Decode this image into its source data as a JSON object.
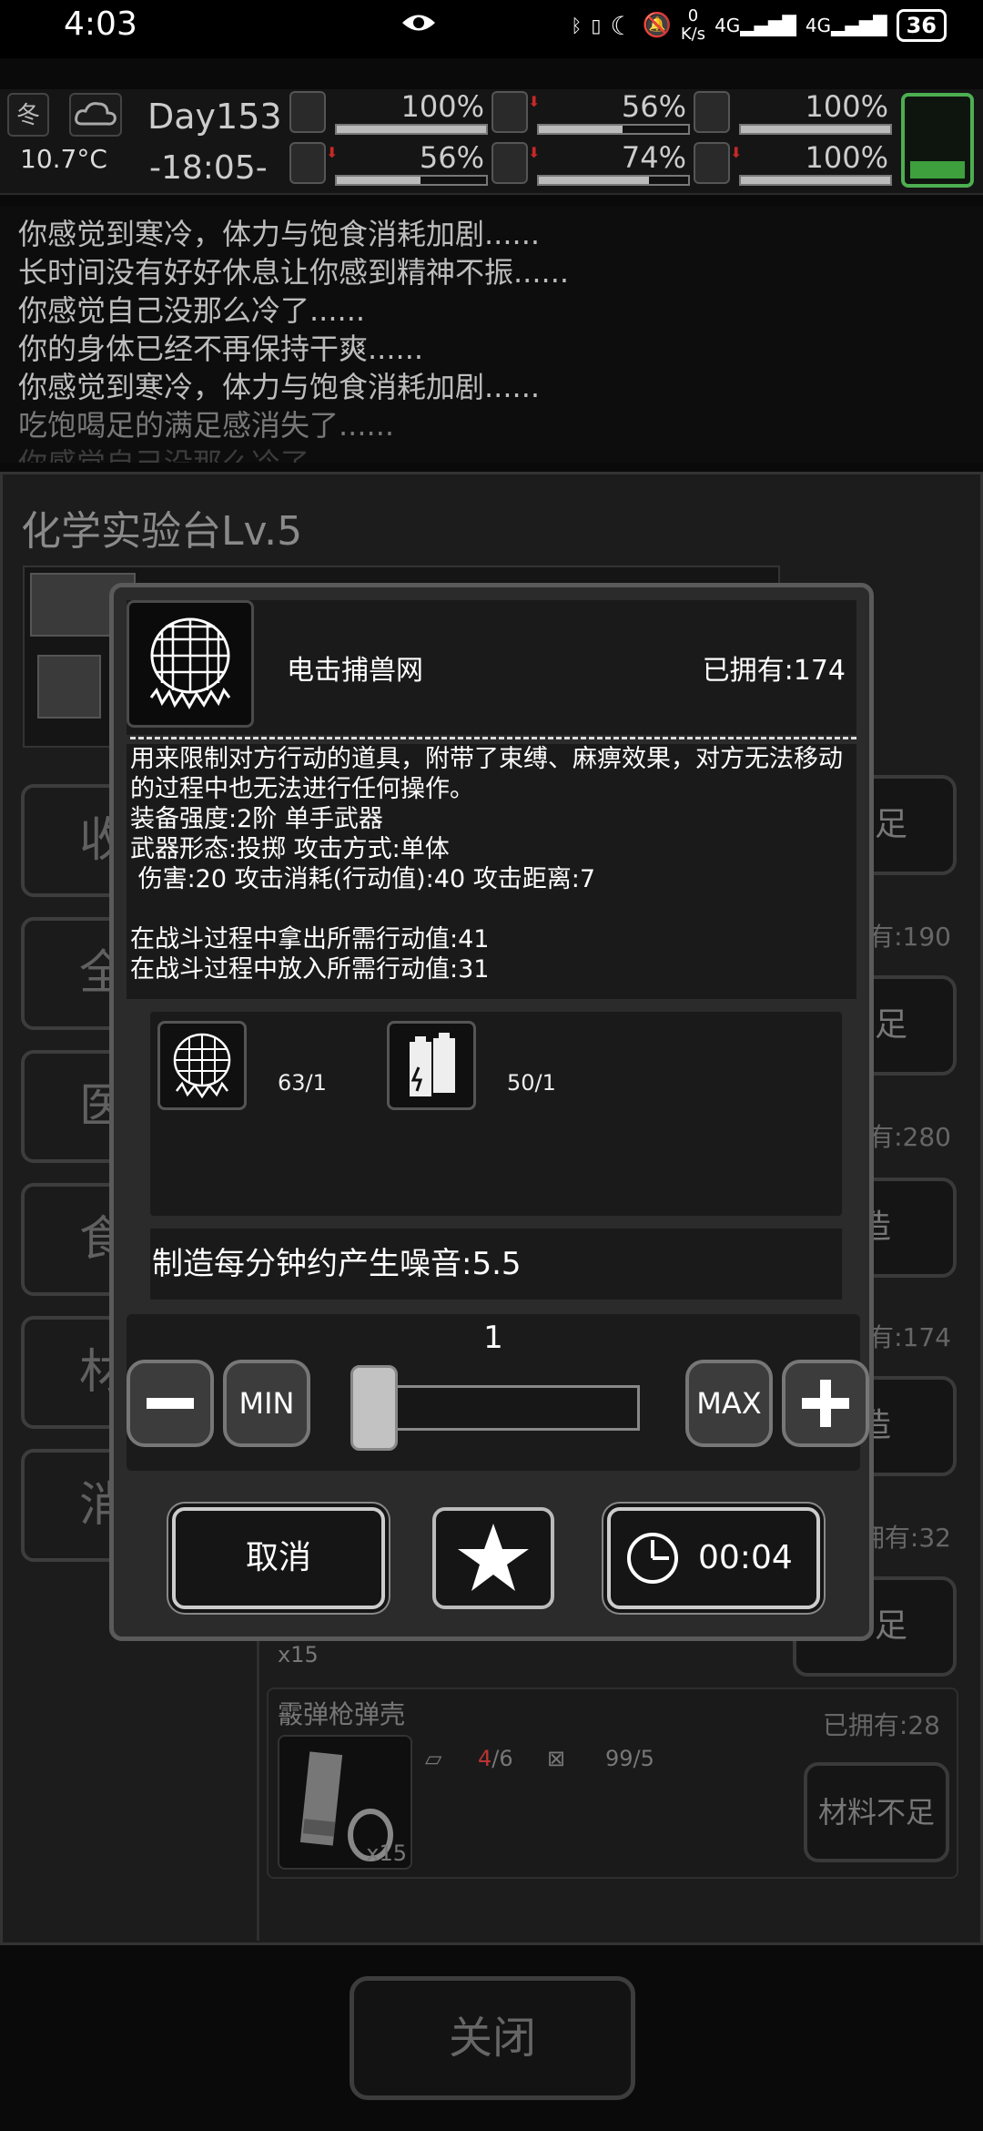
{
  "status_bar": {
    "time": "4:03",
    "net_speed_value": "0",
    "net_speed_unit": "K/s",
    "signal_1": "4G",
    "signal_2": "4G",
    "battery": "36"
  },
  "hud": {
    "season": "冬",
    "temperature": "10.7°C",
    "day": "Day153",
    "clock": "-18:05-",
    "stats": [
      {
        "icon": "medkit-icon",
        "value": "100%",
        "level": 1.0,
        "down": false
      },
      {
        "icon": "stomach-icon",
        "value": "56%",
        "level": 0.56,
        "down": true
      },
      {
        "icon": "mood-icon",
        "value": "100%",
        "level": 1.0,
        "down": false
      },
      {
        "icon": "boot-icon",
        "value": "56%",
        "level": 0.56,
        "down": true
      },
      {
        "icon": "water-drop-icon",
        "value": "74%",
        "level": 0.74,
        "down": true
      },
      {
        "icon": "heart-icon",
        "value": "100%",
        "level": 1.0,
        "down": true
      }
    ],
    "stamina_level": 0.2
  },
  "log": [
    "你感觉到寒冷，体力与饱食消耗加剧......",
    "长时间没有好好休息让你感到精神不振......",
    "你感觉自己没那么冷了......",
    "你的身体已经不再保持干爽......",
    "你感觉到寒冷，体力与饱食消耗加剧......",
    "吃饱喝足的满足感消失了......",
    "你感觉自己没那么冷了......"
  ],
  "background": {
    "title": "化学实验台Lv.5",
    "categories": [
      "收",
      "全",
      "医",
      "食",
      "材",
      "消"
    ],
    "owned_labels": [
      "有:190",
      "有:280",
      "有:174",
      "拥有:32"
    ],
    "craft_buttons": [
      "不足",
      "不足",
      "造",
      "造",
      "不足"
    ],
    "recipe": {
      "name": "霰弹枪弹壳",
      "owned": "已拥有:28",
      "mat1_have": "4",
      "mat1_need": "/6",
      "mat2": "99/5",
      "quantity": "x15",
      "button": "材料不足"
    },
    "partial_quantity": "x15",
    "close_button": "关闭"
  },
  "modal": {
    "item_name": "电击捕兽网",
    "owned": "已拥有:174",
    "description": [
      "用来限制对方行动的道具，附带了束缚、麻痹效果，对方无法移动的过程中也无法进行任何操作。",
      "装备强度:2阶 单手武器",
      "武器形态:投掷 攻击方式:单体",
      " 伤害:20 攻击消耗(行动值):40 攻击距离:7",
      "",
      "在战斗过程中拿出所需行动值:41",
      "在战斗过程中放入所需行动值:31"
    ],
    "materials": [
      {
        "icon": "net-icon",
        "count": "63/1"
      },
      {
        "icon": "battery-icon",
        "count": "50/1"
      }
    ],
    "noise": "制造每分钟约产生噪音:5.5",
    "quantity": "1",
    "min_label": "MIN",
    "max_label": "MAX",
    "cancel_label": "取消",
    "time": "00:04"
  }
}
